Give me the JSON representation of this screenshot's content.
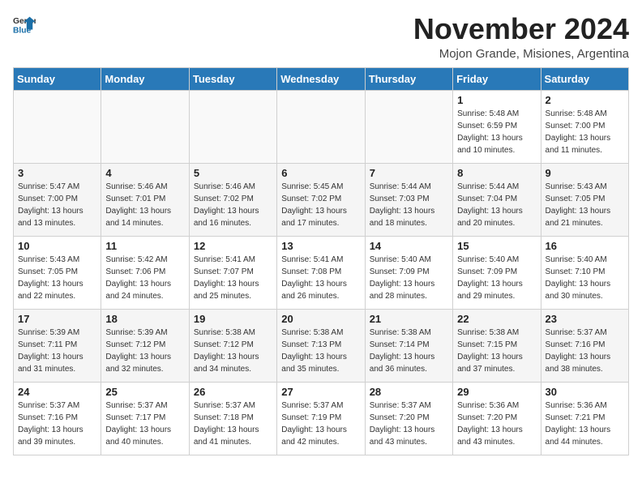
{
  "logo": {
    "general": "General",
    "blue": "Blue"
  },
  "title": {
    "month_year": "November 2024",
    "location": "Mojon Grande, Misiones, Argentina"
  },
  "headers": [
    "Sunday",
    "Monday",
    "Tuesday",
    "Wednesday",
    "Thursday",
    "Friday",
    "Saturday"
  ],
  "weeks": [
    [
      {
        "day": "",
        "sunrise": "",
        "sunset": "",
        "daylight": ""
      },
      {
        "day": "",
        "sunrise": "",
        "sunset": "",
        "daylight": ""
      },
      {
        "day": "",
        "sunrise": "",
        "sunset": "",
        "daylight": ""
      },
      {
        "day": "",
        "sunrise": "",
        "sunset": "",
        "daylight": ""
      },
      {
        "day": "",
        "sunrise": "",
        "sunset": "",
        "daylight": ""
      },
      {
        "day": "1",
        "sunrise": "Sunrise: 5:48 AM",
        "sunset": "Sunset: 6:59 PM",
        "daylight": "Daylight: 13 hours and 10 minutes."
      },
      {
        "day": "2",
        "sunrise": "Sunrise: 5:48 AM",
        "sunset": "Sunset: 7:00 PM",
        "daylight": "Daylight: 13 hours and 11 minutes."
      }
    ],
    [
      {
        "day": "3",
        "sunrise": "Sunrise: 5:47 AM",
        "sunset": "Sunset: 7:00 PM",
        "daylight": "Daylight: 13 hours and 13 minutes."
      },
      {
        "day": "4",
        "sunrise": "Sunrise: 5:46 AM",
        "sunset": "Sunset: 7:01 PM",
        "daylight": "Daylight: 13 hours and 14 minutes."
      },
      {
        "day": "5",
        "sunrise": "Sunrise: 5:46 AM",
        "sunset": "Sunset: 7:02 PM",
        "daylight": "Daylight: 13 hours and 16 minutes."
      },
      {
        "day": "6",
        "sunrise": "Sunrise: 5:45 AM",
        "sunset": "Sunset: 7:02 PM",
        "daylight": "Daylight: 13 hours and 17 minutes."
      },
      {
        "day": "7",
        "sunrise": "Sunrise: 5:44 AM",
        "sunset": "Sunset: 7:03 PM",
        "daylight": "Daylight: 13 hours and 18 minutes."
      },
      {
        "day": "8",
        "sunrise": "Sunrise: 5:44 AM",
        "sunset": "Sunset: 7:04 PM",
        "daylight": "Daylight: 13 hours and 20 minutes."
      },
      {
        "day": "9",
        "sunrise": "Sunrise: 5:43 AM",
        "sunset": "Sunset: 7:05 PM",
        "daylight": "Daylight: 13 hours and 21 minutes."
      }
    ],
    [
      {
        "day": "10",
        "sunrise": "Sunrise: 5:43 AM",
        "sunset": "Sunset: 7:05 PM",
        "daylight": "Daylight: 13 hours and 22 minutes."
      },
      {
        "day": "11",
        "sunrise": "Sunrise: 5:42 AM",
        "sunset": "Sunset: 7:06 PM",
        "daylight": "Daylight: 13 hours and 24 minutes."
      },
      {
        "day": "12",
        "sunrise": "Sunrise: 5:41 AM",
        "sunset": "Sunset: 7:07 PM",
        "daylight": "Daylight: 13 hours and 25 minutes."
      },
      {
        "day": "13",
        "sunrise": "Sunrise: 5:41 AM",
        "sunset": "Sunset: 7:08 PM",
        "daylight": "Daylight: 13 hours and 26 minutes."
      },
      {
        "day": "14",
        "sunrise": "Sunrise: 5:40 AM",
        "sunset": "Sunset: 7:09 PM",
        "daylight": "Daylight: 13 hours and 28 minutes."
      },
      {
        "day": "15",
        "sunrise": "Sunrise: 5:40 AM",
        "sunset": "Sunset: 7:09 PM",
        "daylight": "Daylight: 13 hours and 29 minutes."
      },
      {
        "day": "16",
        "sunrise": "Sunrise: 5:40 AM",
        "sunset": "Sunset: 7:10 PM",
        "daylight": "Daylight: 13 hours and 30 minutes."
      }
    ],
    [
      {
        "day": "17",
        "sunrise": "Sunrise: 5:39 AM",
        "sunset": "Sunset: 7:11 PM",
        "daylight": "Daylight: 13 hours and 31 minutes."
      },
      {
        "day": "18",
        "sunrise": "Sunrise: 5:39 AM",
        "sunset": "Sunset: 7:12 PM",
        "daylight": "Daylight: 13 hours and 32 minutes."
      },
      {
        "day": "19",
        "sunrise": "Sunrise: 5:38 AM",
        "sunset": "Sunset: 7:12 PM",
        "daylight": "Daylight: 13 hours and 34 minutes."
      },
      {
        "day": "20",
        "sunrise": "Sunrise: 5:38 AM",
        "sunset": "Sunset: 7:13 PM",
        "daylight": "Daylight: 13 hours and 35 minutes."
      },
      {
        "day": "21",
        "sunrise": "Sunrise: 5:38 AM",
        "sunset": "Sunset: 7:14 PM",
        "daylight": "Daylight: 13 hours and 36 minutes."
      },
      {
        "day": "22",
        "sunrise": "Sunrise: 5:38 AM",
        "sunset": "Sunset: 7:15 PM",
        "daylight": "Daylight: 13 hours and 37 minutes."
      },
      {
        "day": "23",
        "sunrise": "Sunrise: 5:37 AM",
        "sunset": "Sunset: 7:16 PM",
        "daylight": "Daylight: 13 hours and 38 minutes."
      }
    ],
    [
      {
        "day": "24",
        "sunrise": "Sunrise: 5:37 AM",
        "sunset": "Sunset: 7:16 PM",
        "daylight": "Daylight: 13 hours and 39 minutes."
      },
      {
        "day": "25",
        "sunrise": "Sunrise: 5:37 AM",
        "sunset": "Sunset: 7:17 PM",
        "daylight": "Daylight: 13 hours and 40 minutes."
      },
      {
        "day": "26",
        "sunrise": "Sunrise: 5:37 AM",
        "sunset": "Sunset: 7:18 PM",
        "daylight": "Daylight: 13 hours and 41 minutes."
      },
      {
        "day": "27",
        "sunrise": "Sunrise: 5:37 AM",
        "sunset": "Sunset: 7:19 PM",
        "daylight": "Daylight: 13 hours and 42 minutes."
      },
      {
        "day": "28",
        "sunrise": "Sunrise: 5:37 AM",
        "sunset": "Sunset: 7:20 PM",
        "daylight": "Daylight: 13 hours and 43 minutes."
      },
      {
        "day": "29",
        "sunrise": "Sunrise: 5:36 AM",
        "sunset": "Sunset: 7:20 PM",
        "daylight": "Daylight: 13 hours and 43 minutes."
      },
      {
        "day": "30",
        "sunrise": "Sunrise: 5:36 AM",
        "sunset": "Sunset: 7:21 PM",
        "daylight": "Daylight: 13 hours and 44 minutes."
      }
    ]
  ]
}
